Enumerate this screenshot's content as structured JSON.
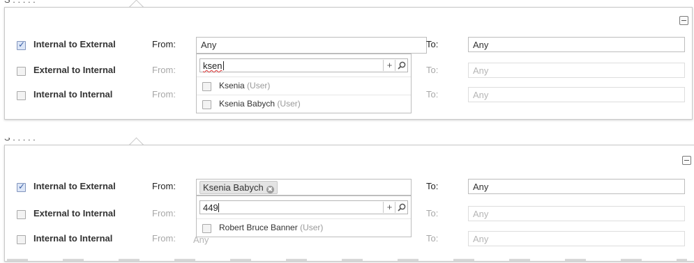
{
  "directions": {
    "internal_to_external": "Internal to External",
    "external_to_internal": "External to Internal",
    "internal_to_internal": "Internal to Internal"
  },
  "labels": {
    "from": "From:",
    "to": "To:"
  },
  "any": "Any",
  "panel1": {
    "from_value": "Any",
    "search_value": "ksen",
    "results": [
      {
        "name": "Ksenia",
        "type": "(User)"
      },
      {
        "name": "Ksenia Babych",
        "type": "(User)"
      }
    ]
  },
  "panel2": {
    "token": "Ksenia Babych",
    "search_value": "449",
    "results": [
      {
        "name": "Robert Bruce Banner",
        "type": "(User)"
      }
    ]
  },
  "icons": {
    "add": "+",
    "search": "magnifier-icon",
    "collapse": "minus-square-icon",
    "remove_token": "✖"
  },
  "colors": {
    "checkbox_checked": "#dce6f7",
    "token_bg": "#e4e4e4"
  }
}
